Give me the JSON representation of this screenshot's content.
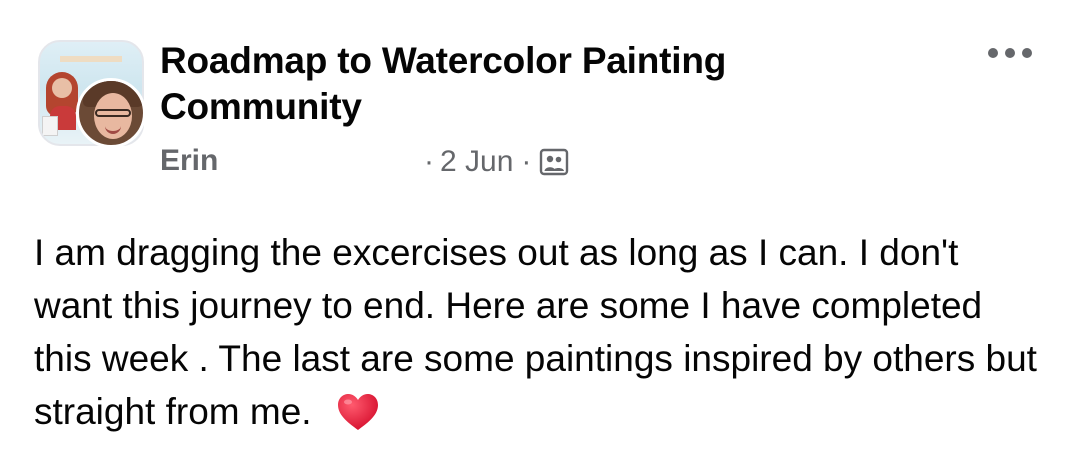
{
  "header": {
    "group_name": "Roadmap to Watercolor Painting Community",
    "author": "Erin",
    "separator": "·",
    "date": "2 Jun",
    "audience_icon": "group-audience-icon",
    "more_icon": "more-options-icon"
  },
  "post": {
    "text": "I am dragging the excercises out as long as I can. I don't want this journey to end. Here are some I have completed this week . The last are some paintings inspired by others but straight from me.",
    "emoji": "heart-emoji"
  },
  "colors": {
    "primary_text": "#050505",
    "secondary_text": "#65676b",
    "heart": "#e41e3f"
  }
}
